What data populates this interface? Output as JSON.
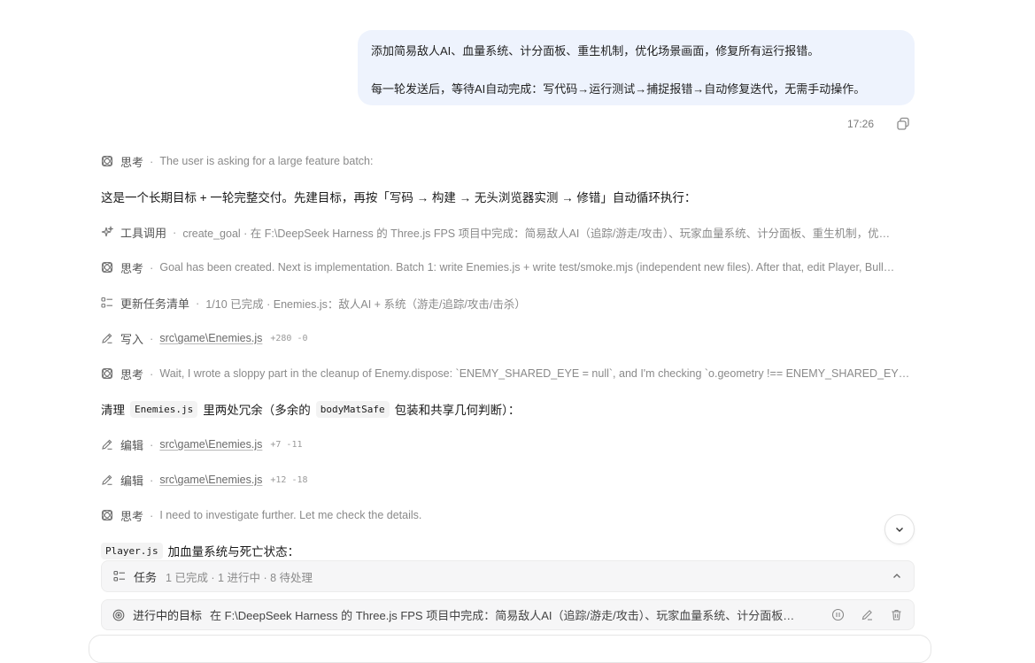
{
  "user_message": {
    "line1": "添加简易敌人AI、血量系统、计分面板、重生机制，优化场景画面，修复所有运行报错。",
    "line2": "每一轮发送后，等待AI自动完成：写代码→运行测试→捕捉报错→自动修复迭代，无需手动操作。",
    "time": "17:26"
  },
  "timeline": {
    "think1": {
      "label": "思考",
      "text": "The user is asking for a large feature batch:"
    },
    "para1": "这是一个长期目标 + 一轮完整交付。先建目标，再按「写码 → 构建 → 无头浏览器实测 → 修错」自动循环执行：",
    "tool1": {
      "label": "工具调用",
      "text": "create_goal · 在 F:\\DeepSeek Harness 的 Three.js FPS 项目中完成：简易敌人AI（追踪/游走/攻击）、玩家血量系统、计分面板、重生机制，优…"
    },
    "think2": {
      "label": "思考",
      "text": "Goal has been created. Next is implementation. Batch 1: write Enemies.js + write test/smoke.mjs (independent new files). After that, edit Player, Bull…"
    },
    "todo1": {
      "label": "更新任务清单",
      "text": "1/10 已完成 · Enemies.js：敌人AI + 系统（游走/追踪/攻击/击杀）"
    },
    "write1": {
      "label": "写入",
      "path": "src\\game\\Enemies.js",
      "diff": "+280 -0"
    },
    "think3": {
      "label": "思考",
      "text": "Wait, I wrote a sloppy part in the cleanup of Enemy.dispose: `ENEMY_SHARED_EYE = null`, and I'm checking `o.geometry !== ENEMY_SHARED_EYE` …"
    },
    "para2": {
      "pre": "清理",
      "code1": "Enemies.js",
      "mid": "里两处冗余（多余的",
      "code2": "bodyMatSafe",
      "post": "包装和共享几何判断）："
    },
    "edit1": {
      "label": "编辑",
      "path": "src\\game\\Enemies.js",
      "diff": "+7 -11"
    },
    "edit2": {
      "label": "编辑",
      "path": "src\\game\\Enemies.js",
      "diff": "+12 -18"
    },
    "think4": {
      "label": "思考",
      "text": "I need to investigate further. Let me check the details."
    },
    "para3": {
      "code": "Player.js",
      "text": "加血量系统与死亡状态："
    },
    "separator": "·"
  },
  "task_panel": {
    "label": "任务",
    "stats": "1 已完成 · 1 进行中 · 8 待处理"
  },
  "goal_panel": {
    "label": "进行中的目标",
    "text": "在 F:\\DeepSeek Harness 的 Three.js FPS 项目中完成：简易敌人AI（追踪/游走/攻击）、玩家血量系统、计分面板、..."
  },
  "colors": {
    "bubble": "#eef3fd",
    "panel": "#f6f6f7",
    "muted": "#8a8a8a"
  }
}
